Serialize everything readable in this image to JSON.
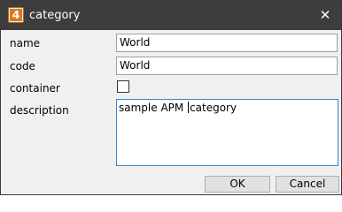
{
  "window": {
    "title": "category",
    "app_icon_glyph": "4",
    "close_glyph": "✕"
  },
  "form": {
    "name": {
      "label": "name",
      "value": "World"
    },
    "code": {
      "label": "code",
      "value": "World"
    },
    "container": {
      "label": "container",
      "checked": false
    },
    "description": {
      "label": "description",
      "value_before_caret": "sample APM ",
      "value_after_caret": "category"
    }
  },
  "buttons": {
    "ok_label": "OK",
    "cancel_label": "Cancel"
  },
  "colors": {
    "titlebar_bg": "#3d3d3d",
    "titlebar_text": "#ffffff",
    "dialog_bg": "#f0f0f0",
    "focus_border": "#3b86cf",
    "app_icon_accent": "#d97a22"
  },
  "icons": {
    "app": "app-logo-icon",
    "close": "close-icon"
  }
}
